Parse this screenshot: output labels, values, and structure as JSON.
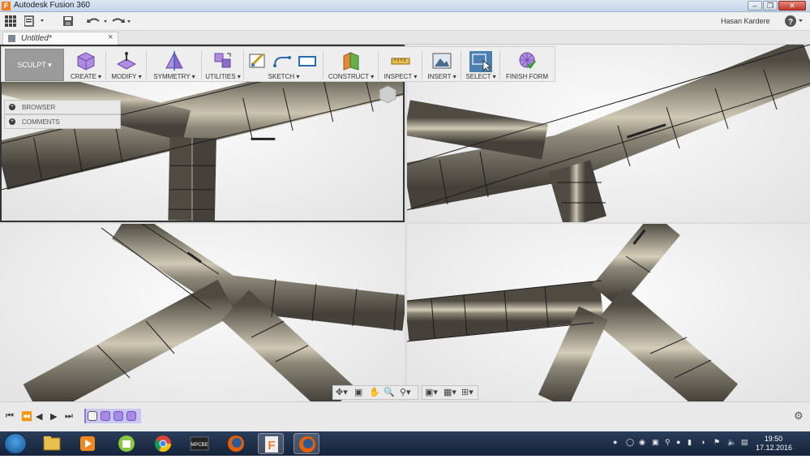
{
  "window": {
    "app_title": "Autodesk Fusion 360",
    "user_name": "Hasan Kardere",
    "min_label": "‒",
    "max_label": "❐",
    "close_label": "✕"
  },
  "document_tab": {
    "label": "Untitled*",
    "close_label": "×"
  },
  "toolbar": {
    "workspace_label": "SCULPT ▾",
    "groups": [
      {
        "label": "CREATE ▾"
      },
      {
        "label": "MODIFY ▾"
      },
      {
        "label": "SYMMETRY ▾"
      },
      {
        "label": "UTILITIES ▾"
      },
      {
        "label": "SKETCH ▾"
      },
      {
        "label": "CONSTRUCT ▾"
      },
      {
        "label": "INSPECT ▾"
      },
      {
        "label": "INSERT ▾"
      },
      {
        "label": "SELECT ▾"
      },
      {
        "label": "FINISH FORM"
      }
    ]
  },
  "panels": {
    "browser_label": "BROWSER",
    "comments_label": "COMMENTS"
  },
  "colors": {
    "tube_dark": "#5e5a50",
    "tube_light": "#cfc8b4",
    "select_active": "#4a7fb0"
  },
  "icons": {
    "grid": "apps-grid-icon",
    "save": "save-icon",
    "undo": "undo-icon",
    "redo": "redo-icon",
    "help": "help-icon"
  },
  "taskbar": {
    "time": "19:50",
    "date": "17.12.2016",
    "apps": [
      "windows-explorer",
      "media-player",
      "android-app",
      "chrome",
      "mpc-be",
      "firefox",
      "fusion-360",
      "firefox"
    ],
    "mpc_label": "MPCBE"
  }
}
